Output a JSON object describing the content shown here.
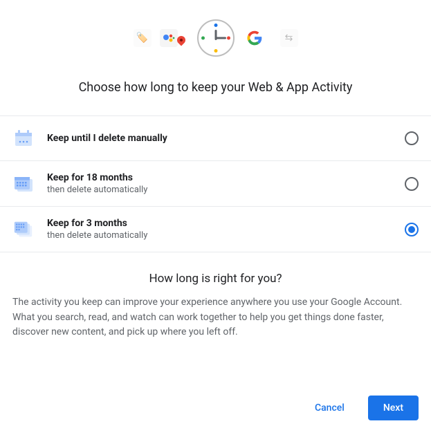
{
  "title": "Choose how long to keep your Web & App Activity",
  "options": [
    {
      "label": "Keep until I delete manually",
      "sub": "",
      "selected": false
    },
    {
      "label": "Keep for 18 months",
      "sub": "then delete automatically",
      "selected": false
    },
    {
      "label": "Keep for 3 months",
      "sub": "then delete automatically",
      "selected": true
    }
  ],
  "info": {
    "title": "How long is right for you?",
    "body": "The activity you keep can improve your experience anywhere you use your Google Account. What you search, read, and watch can work together to help you get things done faster, discover new content, and pick up where you left off."
  },
  "buttons": {
    "cancel": "Cancel",
    "next": "Next"
  }
}
